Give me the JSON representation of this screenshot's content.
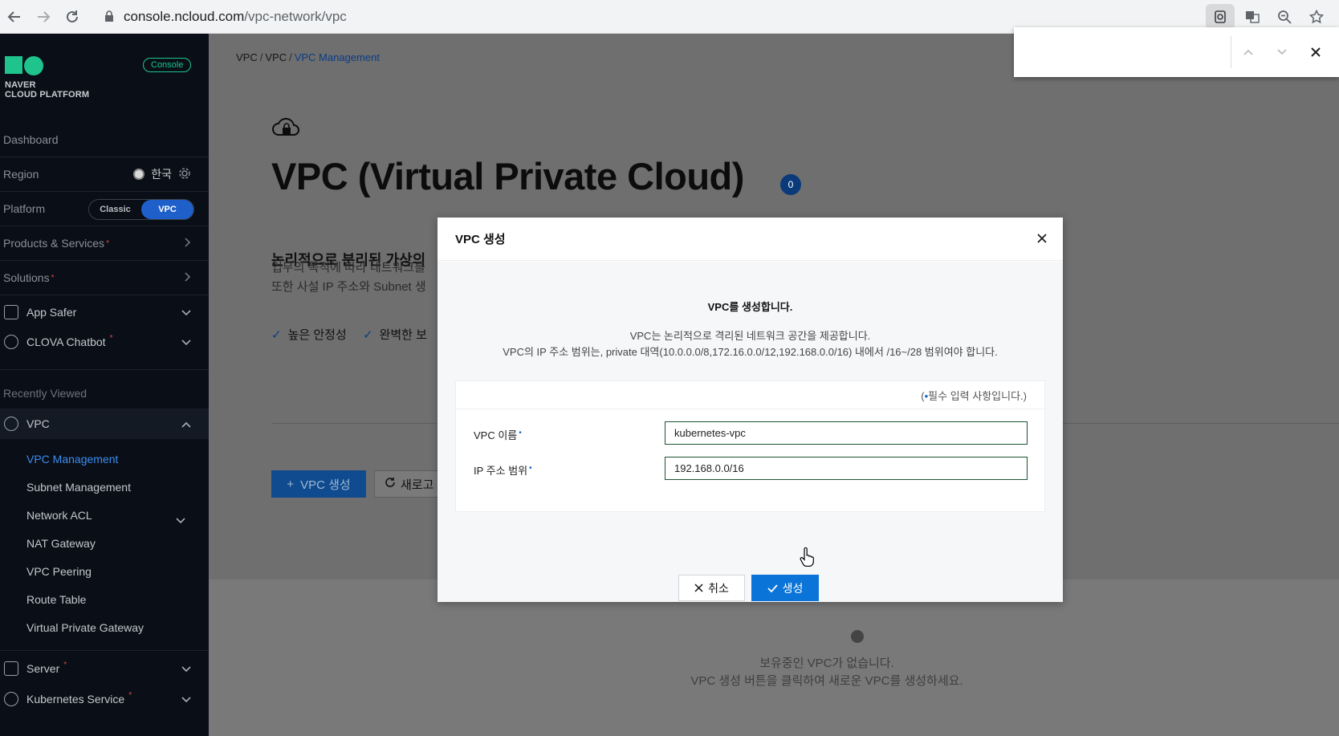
{
  "browser": {
    "url_host": "console.ncloud.com",
    "url_path": "/vpc-network/vpc"
  },
  "sidebar": {
    "logo_line1": "NAVER",
    "logo_line2": "CLOUD PLATFORM",
    "console_badge": "Console",
    "dashboard": "Dashboard",
    "region_label": "Region",
    "region_value": "한국",
    "platform_label": "Platform",
    "platform_classic": "Classic",
    "platform_vpc": "VPC",
    "products_services": "Products & Services",
    "solutions": "Solutions",
    "app_safer": "App Safer",
    "clova_chatbot": "CLOVA Chatbot",
    "recently_viewed": "Recently Viewed",
    "vpc": "VPC",
    "vpc_items": [
      "VPC Management",
      "Subnet Management",
      "Network ACL",
      "NAT Gateway",
      "VPC Peering",
      "Route Table",
      "Virtual Private Gateway"
    ],
    "server": "Server",
    "kubernetes": "Kubernetes Service",
    "required_mark": "*"
  },
  "main": {
    "breadcrumb": [
      "VPC",
      "VPC",
      "VPC Management"
    ],
    "crumb_sep": "/",
    "title": "VPC (Virtual Private Cloud)",
    "title_badge": "0",
    "sub_heading": "논리적으로 분리된 가상의",
    "desc_line1": "업무의 목적에 따라 네트워크를",
    "desc_line2": "또한 사설 IP 주소와 Subnet 생",
    "feature1": "높은 안정성",
    "feature2": "완벽한 보",
    "create_button": "VPC 생성",
    "refresh_button": "새로고",
    "empty_line1": "보유중인 VPC가 없습니다.",
    "empty_line2": "VPC 생성 버튼을 클릭하여 새로운 VPC를 생성하세요."
  },
  "modal": {
    "title": "VPC 생성",
    "heading": "VPC를 생성합니다.",
    "line1": "VPC는 논리적으로 격리된 네트워크 공간을 제공합니다.",
    "line2": "VPC의 IP 주소 범위는, private 대역(10.0.0.0/8,172.16.0.0/12,192.168.0.0/16) 내에서 /16~/28 범위여야 합니다.",
    "required_note": "필수 입력 사항입니다.",
    "required_open": "(",
    "required_close": ")",
    "required_bullet": "•",
    "name_label": "VPC 이름",
    "name_value": "kubernetes-vpc",
    "ip_label": "IP 주소 범위",
    "ip_value": "192.168.0.0/16",
    "cancel_button": "취소",
    "create_button": "생성"
  }
}
